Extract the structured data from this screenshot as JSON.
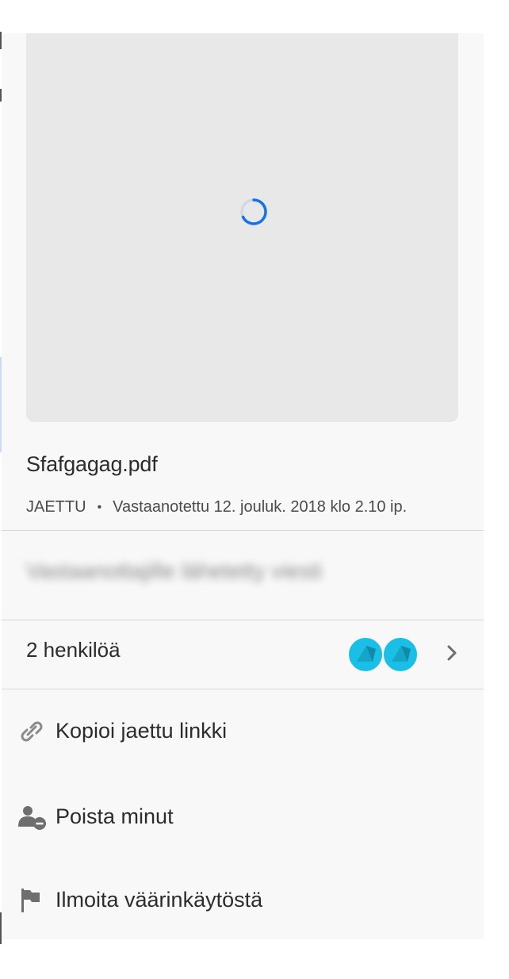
{
  "file": {
    "name": "Sfafgagag.pdf",
    "status": "JAETTU",
    "separator": "•",
    "received": "Vastaanotettu 12. jouluk. 2018 klo 2.10 ip."
  },
  "message": {
    "text": "Vastaanottajille lähetetty viesti"
  },
  "people": {
    "label": "2 henkilöä",
    "avatar_color": "#1bbfe6"
  },
  "actions": [
    {
      "label": "Kopioi jaettu linkki",
      "icon": "link-icon"
    },
    {
      "label": "Poista minut",
      "icon": "remove-user-icon"
    },
    {
      "label": "Ilmoita väärinkäytöstä",
      "icon": "flag-icon"
    }
  ],
  "colors": {
    "spinner": "#1473e6",
    "panel": "#f8f8f8",
    "preview": "#e8e8e8"
  }
}
